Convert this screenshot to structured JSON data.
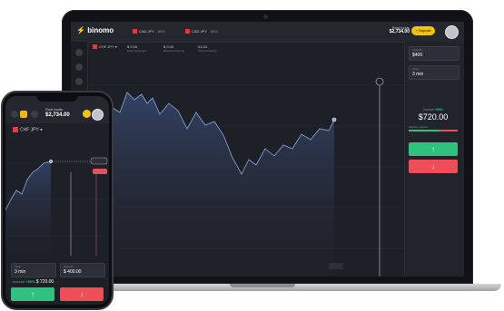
{
  "laptop": {
    "brand": "binomo",
    "tabs": [
      {
        "label": "CAD JPY",
        "pct": "85%"
      },
      {
        "label": "CAD JPY",
        "pct": "85%"
      }
    ],
    "account": {
      "label": "Real funds",
      "value": "$2,734.00"
    },
    "deposit_label": "+ Deposit",
    "asset": "CHF JPY",
    "metrics": [
      {
        "value": "$ 0.00",
        "label": "Total investment"
      },
      {
        "value": "$ 0.00",
        "label": "Expected income"
      },
      {
        "value": "01:24",
        "label": "Time remaining"
      }
    ],
    "panel": {
      "amount_label": "Amount",
      "amount_value": "$400",
      "time_label": "Time",
      "time_value": "3 min",
      "profit_label": "Income",
      "profit_pct": "+80%",
      "profit_value": "$720.00",
      "majority_label": "Majority opinion"
    }
  },
  "phone": {
    "account": {
      "label": "Real funds",
      "value": "$2,734.00"
    },
    "asset": "CHF JPY",
    "time_label": "Time",
    "time_value": "3 min",
    "amount_label": "Amount",
    "amount_value": "$ 400.00",
    "profit_label": "Income",
    "profit_pct": "+80%",
    "profit_value": "$ 720.00"
  },
  "colors": {
    "up": "#2ec27e",
    "down": "#ef4d58",
    "accent": "#f5c400"
  },
  "icons": [
    "avatar",
    "arrow-up-icon",
    "arrow-down-icon"
  ]
}
